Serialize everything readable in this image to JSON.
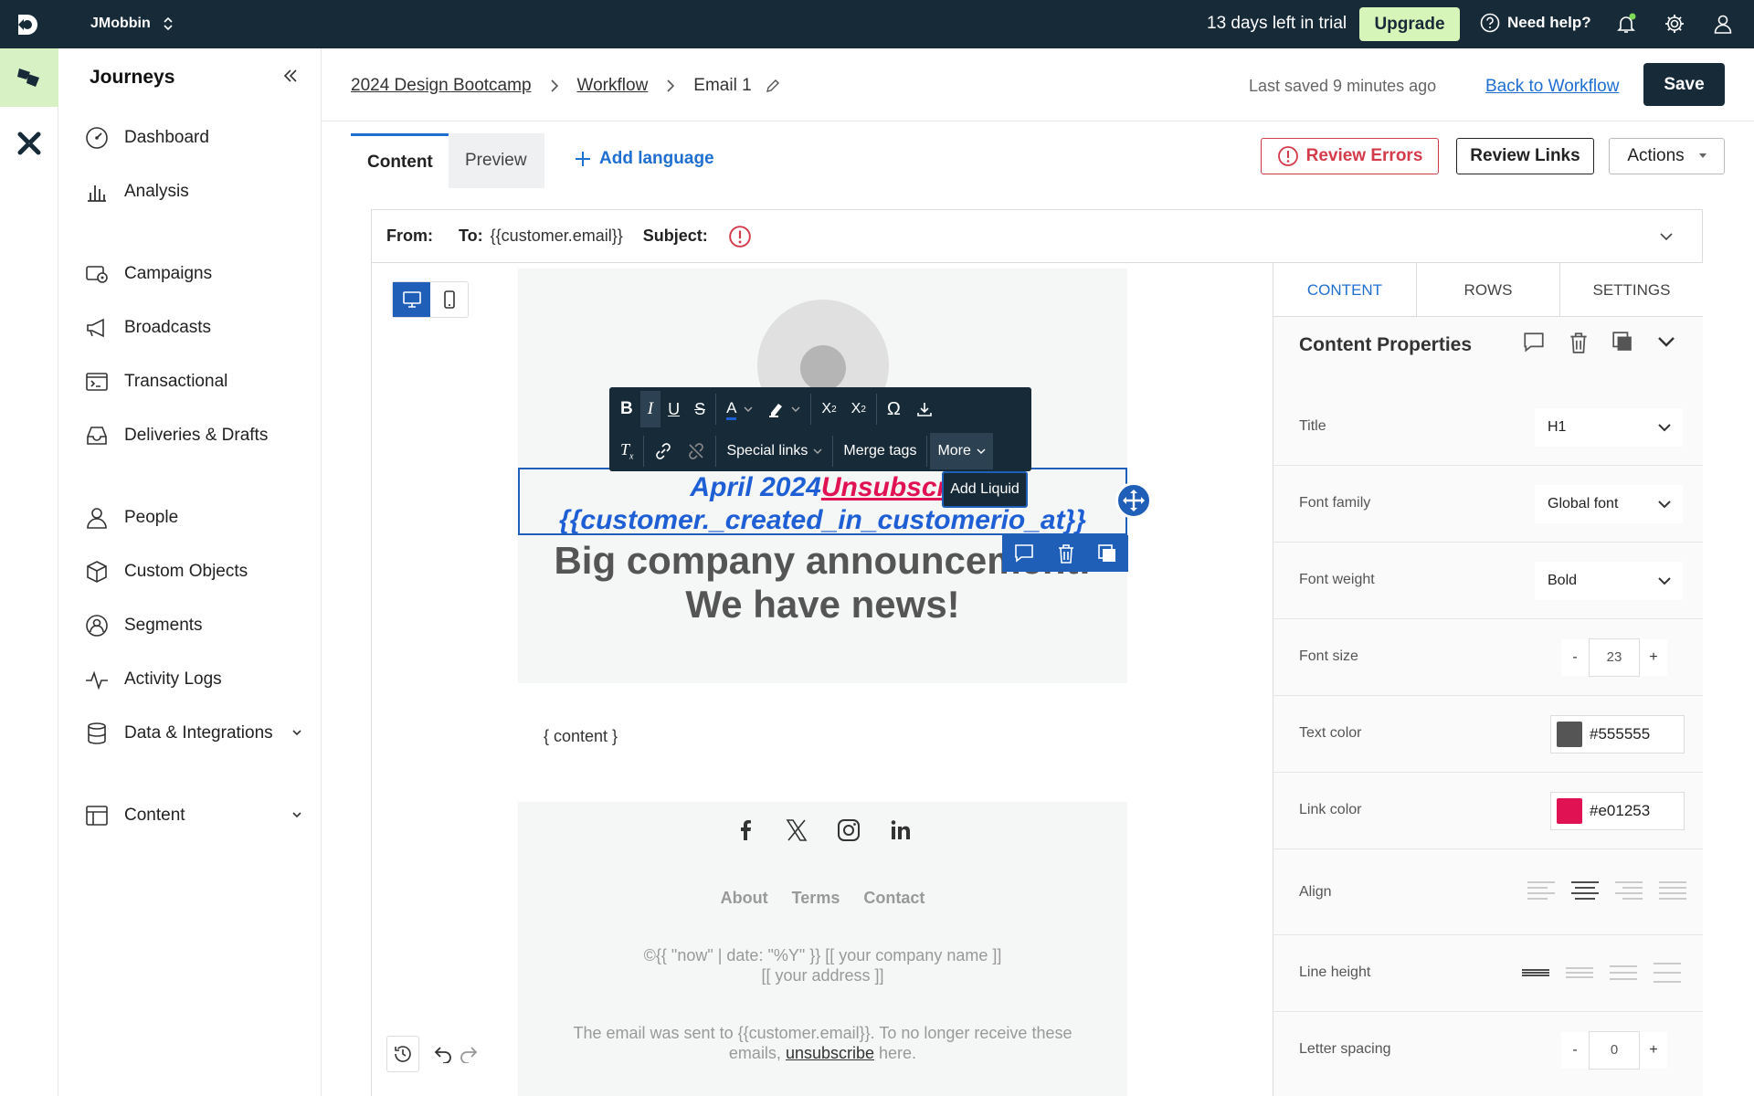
{
  "topbar": {
    "workspace": "JMobbin",
    "trial": "13 days left in trial",
    "upgrade": "Upgrade",
    "help": "Need help?"
  },
  "sidebar": {
    "title": "Journeys",
    "items": [
      {
        "label": "Dashboard",
        "icon": "dashboard-icon"
      },
      {
        "label": "Analysis",
        "icon": "bar-chart-icon"
      },
      {
        "label": "Campaigns",
        "icon": "campaigns-icon"
      },
      {
        "label": "Broadcasts",
        "icon": "megaphone-icon"
      },
      {
        "label": "Transactional",
        "icon": "terminal-icon"
      },
      {
        "label": "Deliveries & Drafts",
        "icon": "inbox-icon"
      },
      {
        "label": "People",
        "icon": "person-icon"
      },
      {
        "label": "Custom Objects",
        "icon": "cube-icon"
      },
      {
        "label": "Segments",
        "icon": "segments-icon"
      },
      {
        "label": "Activity Logs",
        "icon": "pulse-icon"
      },
      {
        "label": "Data & Integrations",
        "icon": "database-icon"
      },
      {
        "label": "Content",
        "icon": "table-icon"
      }
    ]
  },
  "breadcrumb": {
    "item1": "2024 Design Bootcamp",
    "item2": "Workflow",
    "item3": "Email 1"
  },
  "header": {
    "saved": "Last saved 9 minutes ago",
    "back": "Back to Workflow",
    "save": "Save"
  },
  "tabs": {
    "content": "Content",
    "preview": "Preview",
    "add_language": "Add language"
  },
  "buttons": {
    "review_errors": "Review Errors",
    "review_links": "Review Links",
    "actions": "Actions"
  },
  "email_header": {
    "from_label": "From:",
    "to_label": "To:",
    "to_value": "{{customer.email}}",
    "subject_label": "Subject:"
  },
  "toolbar": {
    "special_links": "Special links",
    "merge_tags": "Merge tags",
    "more": "More",
    "add_liquid": "Add Liquid"
  },
  "canvas": {
    "headline_part1": "April 2024",
    "headline_unsub": "Unsubscri",
    "headline_line2": "{{customer._created_in_customerio_at}}",
    "big_line1": "Big company announcement!",
    "big_line2": "We have news!",
    "content_placeholder": "{ content }",
    "footer_links": [
      "About",
      "Terms",
      "Contact"
    ],
    "copyright_line1": "©{{ \"now\" | date: \"%Y\" }} [[ your company name ]]",
    "copyright_line2": "[[ your address ]]",
    "legal_part1": "The email was sent to {{customer.email}}. To no longer receive these emails,",
    "legal_link": "unsubscribe",
    "legal_part2": "here."
  },
  "panel": {
    "tabs": [
      "CONTENT",
      "ROWS",
      "SETTINGS"
    ],
    "title": "Content Properties",
    "title_label": "Title",
    "title_value": "H1",
    "font_family_label": "Font family",
    "font_family_value": "Global font",
    "font_weight_label": "Font weight",
    "font_weight_value": "Bold",
    "font_size_label": "Font size",
    "font_size_value": "23",
    "text_color_label": "Text color",
    "text_color_value": "#555555",
    "link_color_label": "Link color",
    "link_color_value": "#e01253",
    "align_label": "Align",
    "line_height_label": "Line height",
    "letter_spacing_label": "Letter spacing",
    "letter_spacing_value": "0",
    "minus": "-",
    "plus": "+"
  },
  "colors": {
    "topbar": "#172a38",
    "accent": "#1f6fd1",
    "error": "#d43b4a",
    "upgrade_bg": "#d6f5b8",
    "text_color": "#555555",
    "link_color": "#e01253"
  }
}
